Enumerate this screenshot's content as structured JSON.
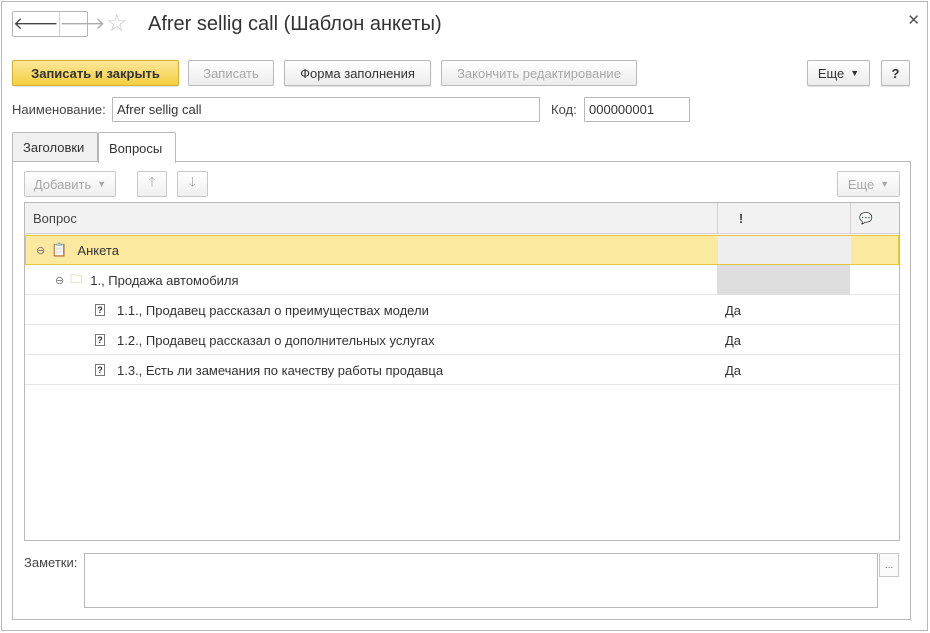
{
  "window": {
    "title": "Afrer sellig call (Шаблон анкеты)",
    "back_glyph": "🡐",
    "forward_glyph": "🡒",
    "star_glyph": "☆",
    "close_glyph": "✕"
  },
  "toolbar": {
    "save_close": "Записать и закрыть",
    "save": "Записать",
    "fill_form": "Форма заполнения",
    "finish_edit": "Закончить редактирование",
    "more": "Еще",
    "help": "?"
  },
  "fields": {
    "name_label": "Наименование:",
    "name_value": "Afrer sellig call",
    "code_label": "Код:",
    "code_value": "000000001"
  },
  "tabs": [
    {
      "label": "Заголовки"
    },
    {
      "label": "Вопросы"
    }
  ],
  "table_toolbar": {
    "add": "Добавить",
    "up_glyph": "🡑",
    "down_glyph": "🡓",
    "more": "Еще"
  },
  "table": {
    "columns": {
      "question": "Вопрос",
      "required_glyph": "!",
      "comment_glyph": "💬"
    },
    "rows": [
      {
        "text": "Анкета",
        "value": ""
      },
      {
        "text": "1., Продажа автомобиля",
        "value": ""
      },
      {
        "text": "1.1., Продавец рассказал о преимуществах модели",
        "value": "Да"
      },
      {
        "text": "1.2., Продавец рассказал о дополнительных услугах",
        "value": "Да"
      },
      {
        "text": "1.3., Есть ли замечания по качеству работы продавца",
        "value": "Да"
      }
    ]
  },
  "notes": {
    "label": "Заметки:",
    "value": "",
    "dots": "..."
  },
  "colors": {
    "accent": "#f3cf3e",
    "selection": "#fbe9a0"
  }
}
